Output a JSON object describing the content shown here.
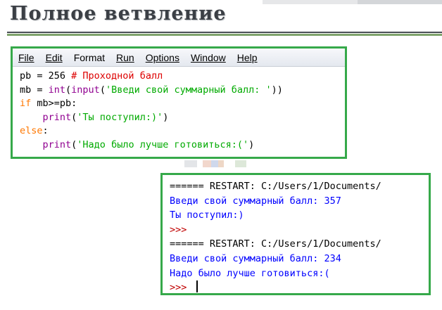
{
  "slide": {
    "title": "Полное ветвление"
  },
  "editor": {
    "menu": [
      "File",
      "Edit",
      "Format",
      "Run",
      "Options",
      "Window",
      "Help"
    ],
    "code": {
      "l1_a": "pb = 256 ",
      "l1_comment": "# Проходной балл",
      "l2_a": "mb = ",
      "l2_int": "int",
      "l2_b": "(",
      "l2_input": "input",
      "l2_c": "(",
      "l2_str": "'Введи свой суммарный балл: '",
      "l2_d": "))",
      "l3_if": "if",
      "l3_rest": " mb>=pb:",
      "l4_indent": "    ",
      "l4_print": "print",
      "l4_a": "(",
      "l4_str": "'Ты поступил:)'",
      "l4_b": ")",
      "l5_else": "else",
      "l5_rest": ":",
      "l6_indent": "    ",
      "l6_print": "print",
      "l6_a": "(",
      "l6_str": "'Надо было лучше готовиться:('",
      "l6_b": ")"
    }
  },
  "shell": {
    "lines": [
      {
        "text": "====== RESTART: C:/Users/1/Documents/",
        "color": "black"
      },
      {
        "text": "Введи свой суммарный балл: 357",
        "color": "blue"
      },
      {
        "text": "Ты поступил:)",
        "color": "blue"
      },
      {
        "text": ">>>",
        "color": "red"
      },
      {
        "text": "====== RESTART: C:/Users/1/Documents/",
        "color": "black"
      },
      {
        "text": "Введи свой суммарный балл: 234",
        "color": "blue"
      },
      {
        "text": "Надо было лучше готовиться:(",
        "color": "blue"
      },
      {
        "text": ">>> ",
        "color": "red"
      }
    ]
  },
  "colors": {
    "window_border": "#36a94a",
    "keyword": "#ff7700",
    "builtin": "#900090",
    "string": "#00aa00",
    "comment": "#dd0000",
    "output": "#0000ff",
    "prompt": "#c00000"
  }
}
